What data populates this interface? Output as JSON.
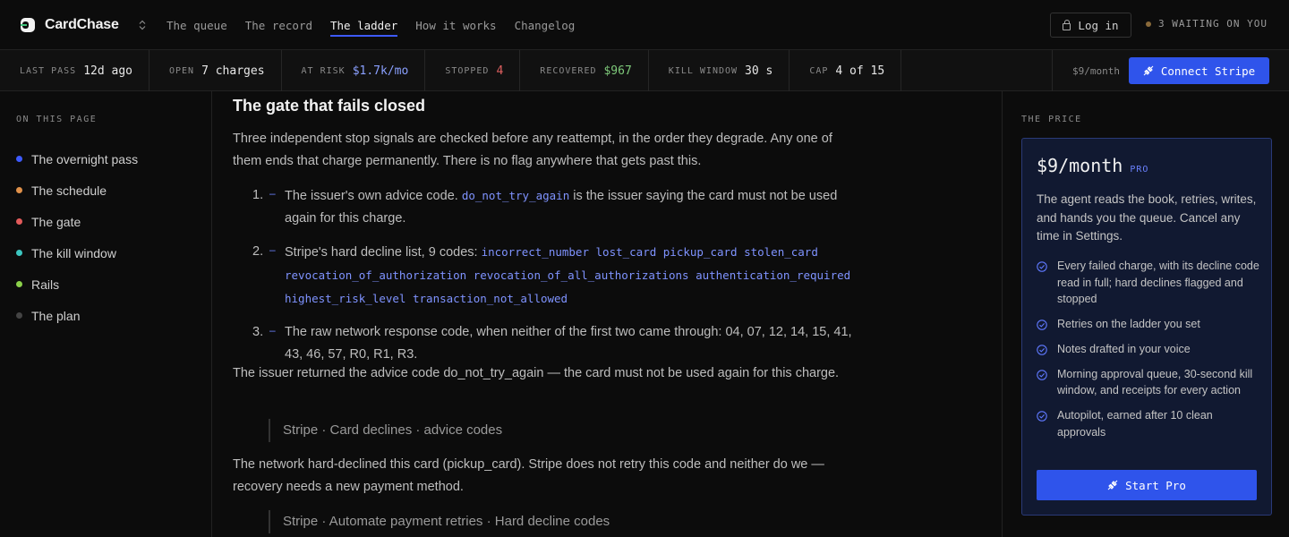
{
  "brand": {
    "name": "CardChase"
  },
  "nav": {
    "links": [
      "The queue",
      "The record",
      "The ladder",
      "How it works",
      "Changelog"
    ],
    "active_index": 2,
    "login_label": "Log in",
    "waiting_label": "3 WAITING ON YOU"
  },
  "stats": [
    {
      "label": "LAST PASS",
      "value": "12d ago",
      "tone": "default"
    },
    {
      "label": "OPEN",
      "value": "7 charges",
      "tone": "default"
    },
    {
      "label": "AT RISK",
      "value": "$1.7k/mo",
      "tone": "blue"
    },
    {
      "label": "STOPPED",
      "value": "4",
      "tone": "red"
    },
    {
      "label": "RECOVERED",
      "value": "$967",
      "tone": "green"
    },
    {
      "label": "KILL WINDOW",
      "value": "30 s",
      "tone": "default"
    },
    {
      "label": "CAP",
      "value": "4 of 15",
      "tone": "default"
    }
  ],
  "stats_right": {
    "price": "$9/month",
    "connect_label": "Connect Stripe"
  },
  "sidebar": {
    "heading": "ON THIS PAGE",
    "items": [
      {
        "label": "The overnight pass",
        "color": "#3d5afe"
      },
      {
        "label": "The schedule",
        "color": "#e0914a"
      },
      {
        "label": "The gate",
        "color": "#e35b5b"
      },
      {
        "label": "The kill window",
        "color": "#3cc6c0"
      },
      {
        "label": "Rails",
        "color": "#8bd14a"
      },
      {
        "label": "The plan",
        "color": "#444444"
      }
    ]
  },
  "main": {
    "heading": "The gate that fails closed",
    "intro": "Three independent stop signals are checked before any reattempt, in the order they degrade. Any one of them ends that charge permanently. There is no flag anywhere that gets past this.",
    "items": [
      {
        "num": "1.",
        "pre": "The issuer's own advice code. ",
        "code": "do_not_try_again",
        "post": " is the issuer saying the card must not be used again for this charge."
      },
      {
        "num": "2.",
        "pre": "Stripe's hard decline list, 9 codes: ",
        "code": "incorrect_number lost_card pickup_card stolen_card revocation_of_authorization revocation_of_all_authorizations authentication_required highest_risk_level transaction_not_allowed",
        "post": ""
      },
      {
        "num": "3.",
        "pre": "The raw network response code, when neither of the first two came through: 04, 07, 12, 14, 15, 41, 43, 46, 57, R0, R1, R3.",
        "code": "",
        "post": ""
      }
    ],
    "para2": "The issuer returned the advice code do_not_try_again — the card must not be used again for this charge.",
    "quote1": "Stripe · Card declines · advice codes",
    "para3": "The network hard-declined this card (pickup_card). Stripe does not retry this code and neither do we — recovery needs a new payment method.",
    "quote2": "Stripe · Automate payment retries · Hard decline codes"
  },
  "price_panel": {
    "heading": "THE PRICE",
    "price": "$9/month",
    "tier": "PRO",
    "description": "The agent reads the book, retries, writes, and hands you the queue. Cancel any time in Settings.",
    "features": [
      "Every failed charge, with its decline code read in full; hard declines flagged and stopped",
      "Retries on the ladder you set",
      "Notes drafted in your voice",
      "Morning approval queue, 30-second kill window, and receipts for every action",
      "Autopilot, earned after 10 clean approvals"
    ],
    "cta": "Start Pro"
  },
  "colors": {
    "accent": "#2f54eb",
    "link_code": "#7f93ff",
    "card_bg": "#111931"
  }
}
